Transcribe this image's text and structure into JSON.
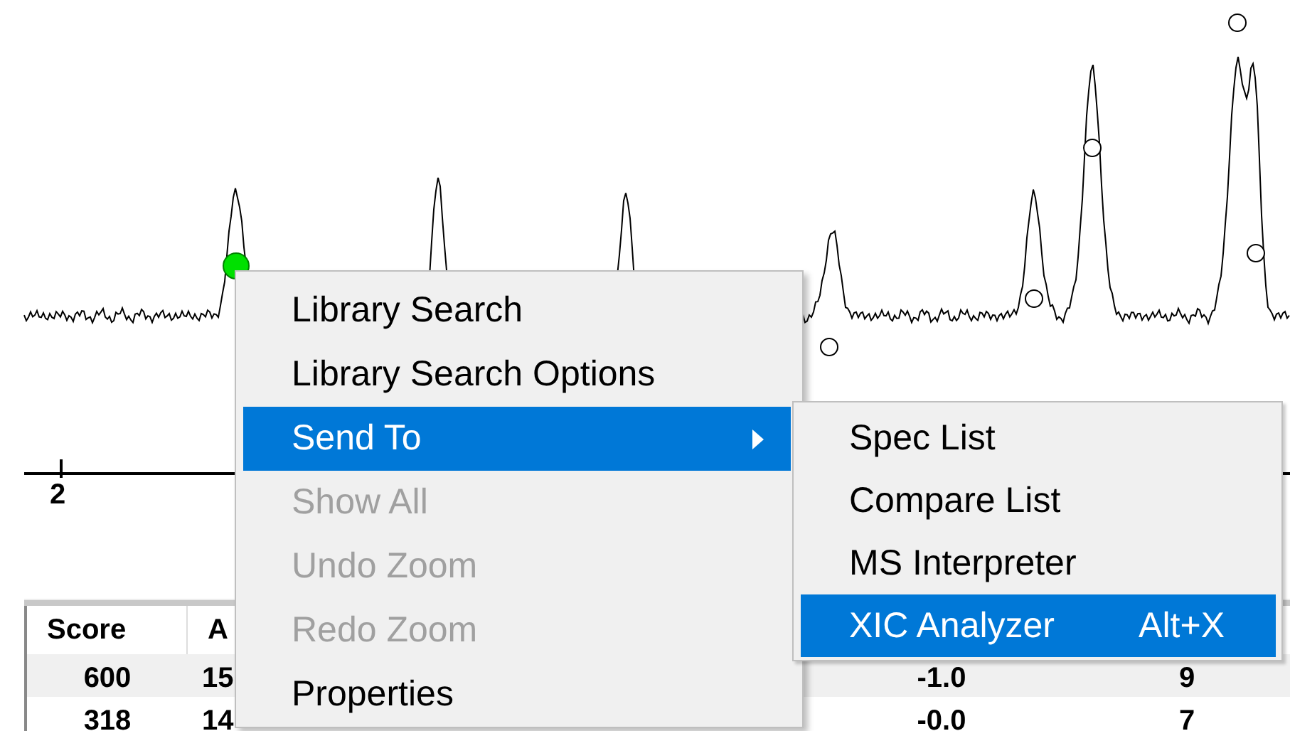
{
  "chart": {
    "axis_labels": [
      "2"
    ]
  },
  "table": {
    "columns": [
      "Score",
      "A"
    ],
    "rows": [
      {
        "selected": true,
        "cells": [
          "600",
          "15",
          "-1.0",
          "9"
        ]
      },
      {
        "selected": false,
        "cells": [
          "318",
          "14",
          "-0.0",
          "7"
        ]
      }
    ]
  },
  "context_menu": {
    "items": [
      {
        "label": "Library Search",
        "disabled": false,
        "selected": false,
        "submenu": false
      },
      {
        "label": "Library Search Options",
        "disabled": false,
        "selected": false,
        "submenu": false
      },
      {
        "label": "Send To",
        "disabled": false,
        "selected": true,
        "submenu": true
      },
      {
        "label": "Show All",
        "disabled": true,
        "selected": false,
        "submenu": false
      },
      {
        "label": "Undo Zoom",
        "disabled": true,
        "selected": false,
        "submenu": false
      },
      {
        "label": "Redo Zoom",
        "disabled": true,
        "selected": false,
        "submenu": false
      },
      {
        "label": "Properties",
        "disabled": false,
        "selected": false,
        "submenu": false
      }
    ]
  },
  "submenu": {
    "items": [
      {
        "label": "Spec List",
        "selected": false
      },
      {
        "label": "Compare List",
        "selected": false
      },
      {
        "label": "MS Interpreter",
        "selected": false
      },
      {
        "label": "XIC Analyzer",
        "shortcut": "Alt+X",
        "selected": true
      }
    ]
  }
}
